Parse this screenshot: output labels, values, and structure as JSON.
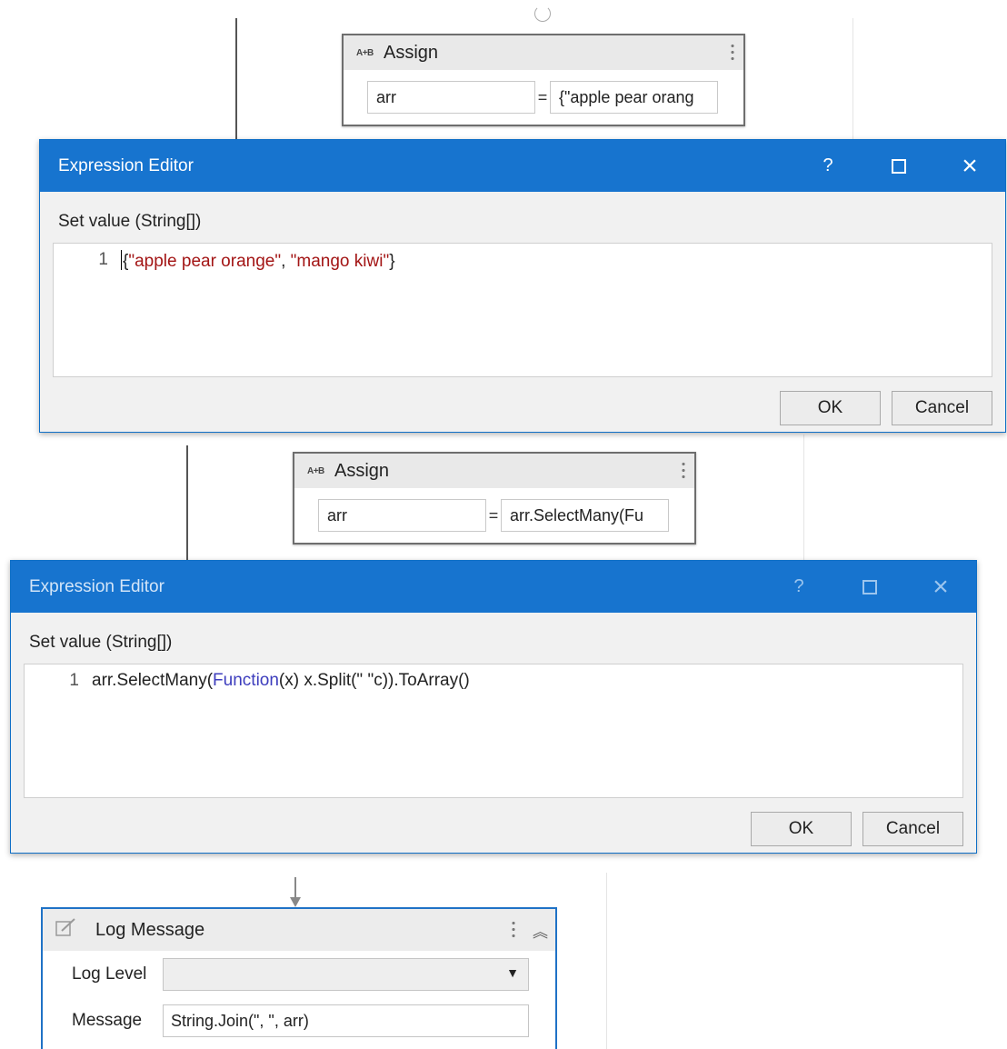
{
  "assign_activity_1": {
    "icon": "A+B",
    "title": "Assign",
    "target": "arr",
    "equals": "=",
    "value": "{\"apple pear orang"
  },
  "expression_editor_1": {
    "title": "Expression Editor",
    "help": "?",
    "label": "Set value (String[])",
    "line_number": "1",
    "code_open_brace": "{",
    "code_string_1": "\"apple pear orange\"",
    "code_sep": ", ",
    "code_string_2": "\"mango kiwi\"",
    "code_close_brace": "}",
    "ok": "OK",
    "cancel": "Cancel"
  },
  "assign_activity_2": {
    "icon": "A+B",
    "title": "Assign",
    "target": "arr",
    "equals": "=",
    "value": "arr.SelectMany(Fu"
  },
  "expression_editor_2": {
    "title": "Expression Editor",
    "help": "?",
    "label": "Set value (String[])",
    "line_number": "1",
    "code_part_1": "arr.SelectMany(",
    "code_keyword": "Function",
    "code_part_2": "(x) x.Split(\" \"c)).ToArray()",
    "ok": "OK",
    "cancel": "Cancel"
  },
  "log_message_activity": {
    "title": "Log Message",
    "log_level_label": "Log Level",
    "log_level_value": "",
    "message_label": "Message",
    "message_value": "String.Join(\", \", arr)"
  },
  "colors": {
    "dialog_titlebar": "#1774cf",
    "string_literal": "#a31515",
    "keyword": "#3d3dbd",
    "log_activity_border": "#1f72c6"
  },
  "icons": [
    "assign-icon",
    "menu-dots-icon",
    "help-icon",
    "maximize-icon",
    "close-icon",
    "log-message-icon",
    "collapse-icon",
    "dropdown-arrow-icon",
    "flow-arrow-icon"
  ]
}
